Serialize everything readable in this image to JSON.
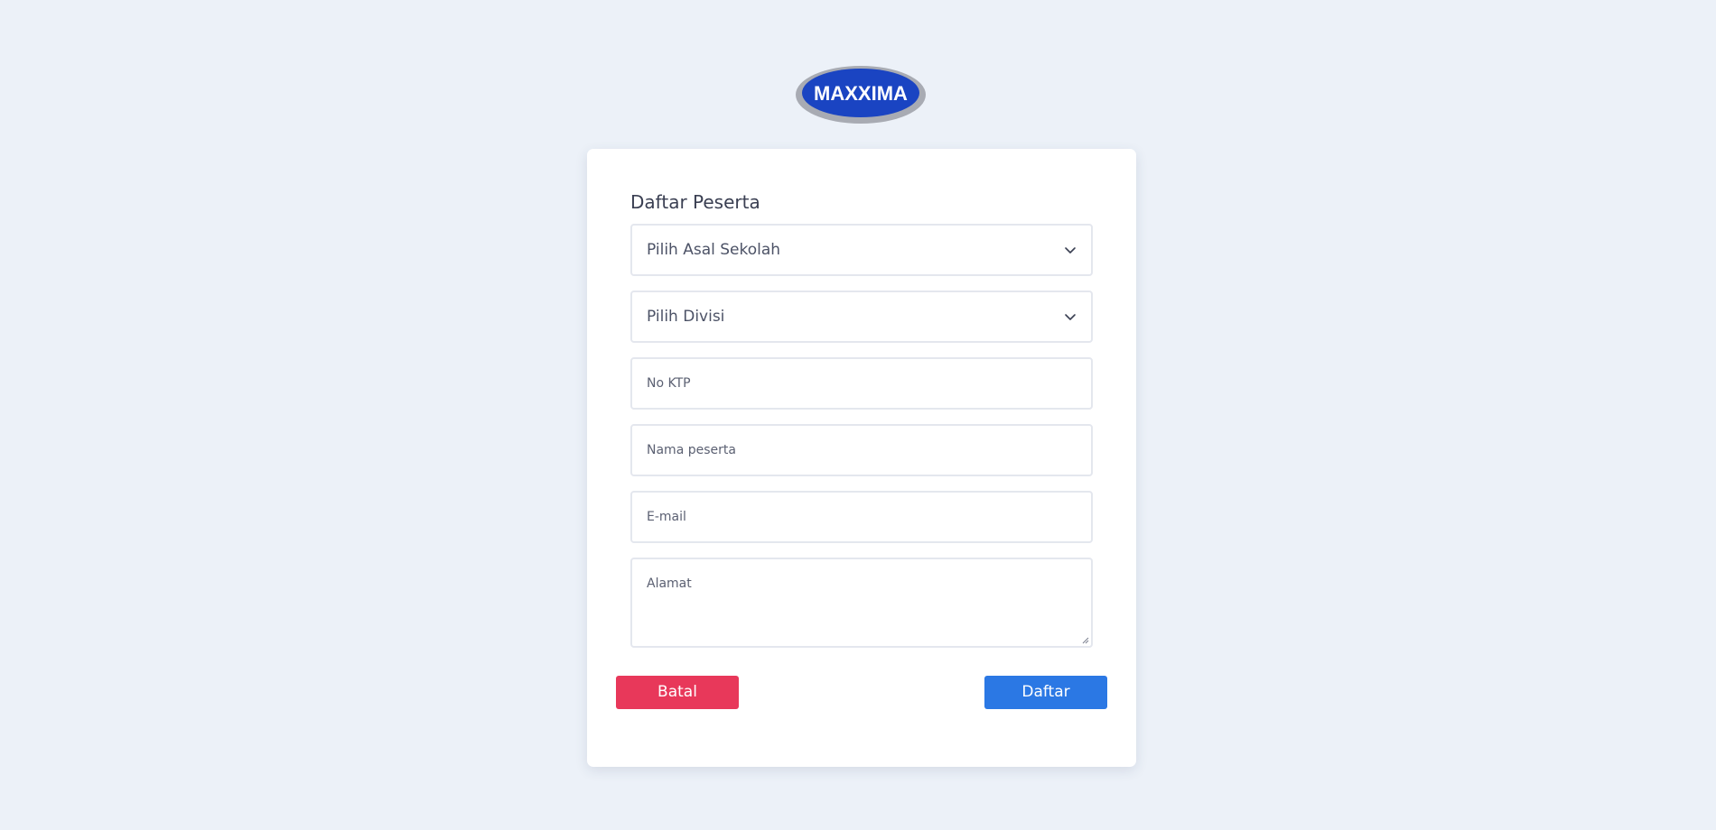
{
  "brand": {
    "logo_text": "MAXXIMA",
    "colors": {
      "logo_blue": "#1a44c2",
      "logo_ring": "#a8abb3"
    }
  },
  "form": {
    "title": "Daftar Peserta",
    "school_select": {
      "value": "Pilih Asal Sekolah",
      "icon": "chevron-down-icon"
    },
    "division_select": {
      "value": "Pilih Divisi",
      "icon": "chevron-down-icon"
    },
    "ktp_input": {
      "placeholder": "No KTP",
      "value": ""
    },
    "name_input": {
      "placeholder": "Nama peserta",
      "value": ""
    },
    "email_input": {
      "placeholder": "E-mail",
      "value": ""
    },
    "address_textarea": {
      "placeholder": "Alamat",
      "value": ""
    },
    "cancel_label": "Batal",
    "submit_label": "Daftar"
  },
  "colors": {
    "background": "#ecf1f8",
    "cancel_button": "#e8385a",
    "submit_button": "#2b78e4"
  }
}
